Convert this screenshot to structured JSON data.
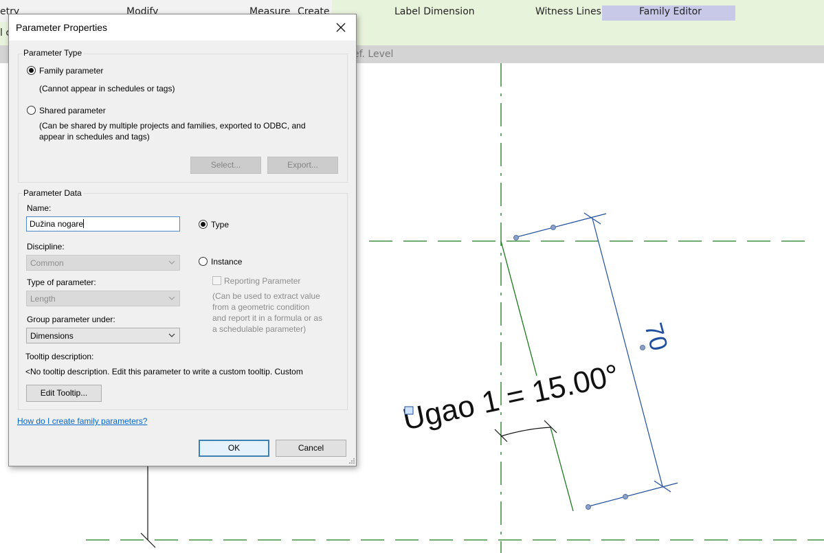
{
  "ribbon": {
    "partial_left_1": "etry",
    "tab_modify": "Modify",
    "tab_measure": "Measure",
    "tab_create": "Create",
    "tab_label_dimension": "Label Dimension",
    "tab_witness_lines": "Witness Lines",
    "tab_family_editor": "Family Editor",
    "family_editor_color": "#c8c8e8",
    "context_color": "#e8f3dc",
    "second_row_stub": "l c"
  },
  "viewbar": {
    "label": "ef. Level"
  },
  "canvas": {
    "angle_label": "Ugao 1 = 15.00°",
    "dimension_label": "70",
    "dimension_color": "#1f4e9e",
    "ref_line_color": "#1a7a1a"
  },
  "dialog": {
    "title": "Parameter Properties",
    "close_icon": "close-icon",
    "parameter_type": {
      "legend": "Parameter Type",
      "family_label": "Family parameter",
      "family_desc": "(Cannot appear in schedules or tags)",
      "shared_label": "Shared parameter",
      "shared_desc_1": "(Can be shared by multiple projects and families, exported to ODBC, and",
      "shared_desc_2": "appear in schedules and tags)",
      "select_button": "Select...",
      "export_button": "Export...",
      "selected": "Family parameter"
    },
    "parameter_data": {
      "legend": "Parameter Data",
      "name_label": "Name:",
      "name_value": "Dužina nogare",
      "discipline_label": "Discipline:",
      "discipline_value": "Common",
      "type_label": "Type of parameter:",
      "type_value": "Length",
      "group_label": "Group parameter under:",
      "group_value": "Dimensions",
      "type_radio": "Type",
      "instance_radio": "Instance",
      "selected": "Type",
      "reporting_label": "Reporting Parameter",
      "reporting_desc_1": "(Can be used to extract value",
      "reporting_desc_2": "from a geometric condition",
      "reporting_desc_3": "and report it in a formula or as",
      "reporting_desc_4": "a schedulable parameter)",
      "tooltip_label": "Tooltip description:",
      "tooltip_text": "<No tooltip description. Edit this parameter to write a custom tooltip. Custom",
      "edit_tooltip_button": "Edit Tooltip..."
    },
    "help_link": "How do I create family parameters?",
    "ok_button": "OK",
    "cancel_button": "Cancel"
  }
}
